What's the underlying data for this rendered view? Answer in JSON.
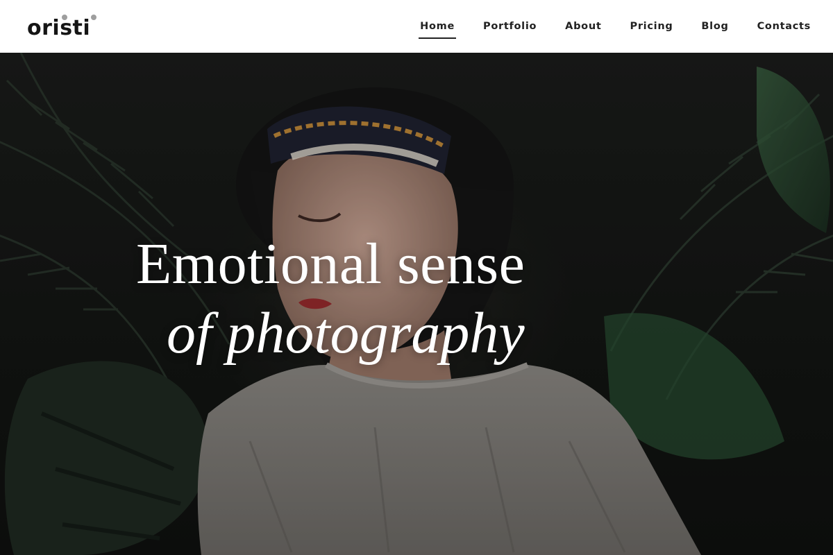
{
  "brand": {
    "logo_text": "oristi"
  },
  "nav": {
    "items": [
      {
        "label": "Home",
        "active": true
      },
      {
        "label": "Portfolio",
        "active": false
      },
      {
        "label": "About",
        "active": false
      },
      {
        "label": "Pricing",
        "active": false
      },
      {
        "label": "Blog",
        "active": false
      },
      {
        "label": "Contacts",
        "active": false
      }
    ]
  },
  "hero": {
    "headline_line1": "Emotional sense",
    "headline_line2": "of photography",
    "image_subject": "woman-portrait-with-palm-leaves"
  },
  "colors": {
    "header_bg": "#ffffff",
    "text_dark": "#222222",
    "logo_dot": "#9e9e9e",
    "headline": "#ffffff",
    "leaf_green": "#2f5a3a"
  }
}
